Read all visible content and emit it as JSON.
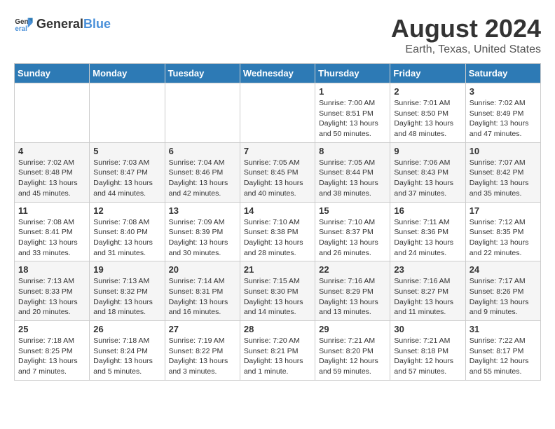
{
  "header": {
    "logo_general": "General",
    "logo_blue": "Blue",
    "month_year": "August 2024",
    "location": "Earth, Texas, United States"
  },
  "days_of_week": [
    "Sunday",
    "Monday",
    "Tuesday",
    "Wednesday",
    "Thursday",
    "Friday",
    "Saturday"
  ],
  "weeks": [
    [
      {
        "day": "",
        "info": ""
      },
      {
        "day": "",
        "info": ""
      },
      {
        "day": "",
        "info": ""
      },
      {
        "day": "",
        "info": ""
      },
      {
        "day": "1",
        "info": "Sunrise: 7:00 AM\nSunset: 8:51 PM\nDaylight: 13 hours\nand 50 minutes."
      },
      {
        "day": "2",
        "info": "Sunrise: 7:01 AM\nSunset: 8:50 PM\nDaylight: 13 hours\nand 48 minutes."
      },
      {
        "day": "3",
        "info": "Sunrise: 7:02 AM\nSunset: 8:49 PM\nDaylight: 13 hours\nand 47 minutes."
      }
    ],
    [
      {
        "day": "4",
        "info": "Sunrise: 7:02 AM\nSunset: 8:48 PM\nDaylight: 13 hours\nand 45 minutes."
      },
      {
        "day": "5",
        "info": "Sunrise: 7:03 AM\nSunset: 8:47 PM\nDaylight: 13 hours\nand 44 minutes."
      },
      {
        "day": "6",
        "info": "Sunrise: 7:04 AM\nSunset: 8:46 PM\nDaylight: 13 hours\nand 42 minutes."
      },
      {
        "day": "7",
        "info": "Sunrise: 7:05 AM\nSunset: 8:45 PM\nDaylight: 13 hours\nand 40 minutes."
      },
      {
        "day": "8",
        "info": "Sunrise: 7:05 AM\nSunset: 8:44 PM\nDaylight: 13 hours\nand 38 minutes."
      },
      {
        "day": "9",
        "info": "Sunrise: 7:06 AM\nSunset: 8:43 PM\nDaylight: 13 hours\nand 37 minutes."
      },
      {
        "day": "10",
        "info": "Sunrise: 7:07 AM\nSunset: 8:42 PM\nDaylight: 13 hours\nand 35 minutes."
      }
    ],
    [
      {
        "day": "11",
        "info": "Sunrise: 7:08 AM\nSunset: 8:41 PM\nDaylight: 13 hours\nand 33 minutes."
      },
      {
        "day": "12",
        "info": "Sunrise: 7:08 AM\nSunset: 8:40 PM\nDaylight: 13 hours\nand 31 minutes."
      },
      {
        "day": "13",
        "info": "Sunrise: 7:09 AM\nSunset: 8:39 PM\nDaylight: 13 hours\nand 30 minutes."
      },
      {
        "day": "14",
        "info": "Sunrise: 7:10 AM\nSunset: 8:38 PM\nDaylight: 13 hours\nand 28 minutes."
      },
      {
        "day": "15",
        "info": "Sunrise: 7:10 AM\nSunset: 8:37 PM\nDaylight: 13 hours\nand 26 minutes."
      },
      {
        "day": "16",
        "info": "Sunrise: 7:11 AM\nSunset: 8:36 PM\nDaylight: 13 hours\nand 24 minutes."
      },
      {
        "day": "17",
        "info": "Sunrise: 7:12 AM\nSunset: 8:35 PM\nDaylight: 13 hours\nand 22 minutes."
      }
    ],
    [
      {
        "day": "18",
        "info": "Sunrise: 7:13 AM\nSunset: 8:33 PM\nDaylight: 13 hours\nand 20 minutes."
      },
      {
        "day": "19",
        "info": "Sunrise: 7:13 AM\nSunset: 8:32 PM\nDaylight: 13 hours\nand 18 minutes."
      },
      {
        "day": "20",
        "info": "Sunrise: 7:14 AM\nSunset: 8:31 PM\nDaylight: 13 hours\nand 16 minutes."
      },
      {
        "day": "21",
        "info": "Sunrise: 7:15 AM\nSunset: 8:30 PM\nDaylight: 13 hours\nand 14 minutes."
      },
      {
        "day": "22",
        "info": "Sunrise: 7:16 AM\nSunset: 8:29 PM\nDaylight: 13 hours\nand 13 minutes."
      },
      {
        "day": "23",
        "info": "Sunrise: 7:16 AM\nSunset: 8:27 PM\nDaylight: 13 hours\nand 11 minutes."
      },
      {
        "day": "24",
        "info": "Sunrise: 7:17 AM\nSunset: 8:26 PM\nDaylight: 13 hours\nand 9 minutes."
      }
    ],
    [
      {
        "day": "25",
        "info": "Sunrise: 7:18 AM\nSunset: 8:25 PM\nDaylight: 13 hours\nand 7 minutes."
      },
      {
        "day": "26",
        "info": "Sunrise: 7:18 AM\nSunset: 8:24 PM\nDaylight: 13 hours\nand 5 minutes."
      },
      {
        "day": "27",
        "info": "Sunrise: 7:19 AM\nSunset: 8:22 PM\nDaylight: 13 hours\nand 3 minutes."
      },
      {
        "day": "28",
        "info": "Sunrise: 7:20 AM\nSunset: 8:21 PM\nDaylight: 13 hours\nand 1 minute."
      },
      {
        "day": "29",
        "info": "Sunrise: 7:21 AM\nSunset: 8:20 PM\nDaylight: 12 hours\nand 59 minutes."
      },
      {
        "day": "30",
        "info": "Sunrise: 7:21 AM\nSunset: 8:18 PM\nDaylight: 12 hours\nand 57 minutes."
      },
      {
        "day": "31",
        "info": "Sunrise: 7:22 AM\nSunset: 8:17 PM\nDaylight: 12 hours\nand 55 minutes."
      }
    ]
  ]
}
